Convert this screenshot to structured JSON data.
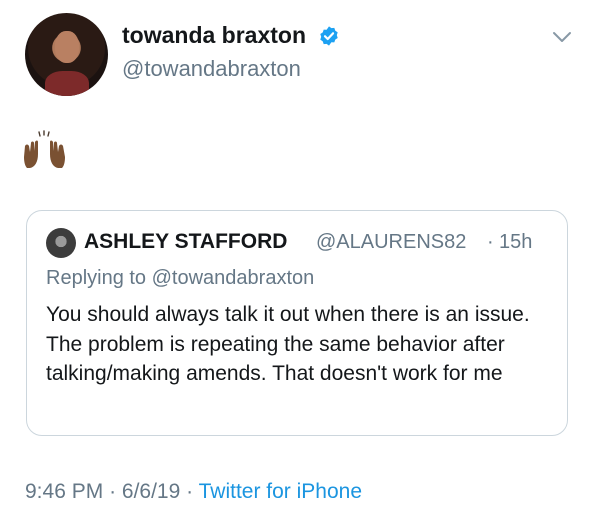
{
  "tweet": {
    "author_name": "towanda braxton",
    "author_handle": "@towandabraxton",
    "verified": true,
    "body_emoji": "🙌🏾",
    "time": "9:46 PM",
    "separator": "·",
    "date": "6/6/19",
    "source": "Twitter for iPhone"
  },
  "quoted_tweet": {
    "author_name": "ASHLEY STAFFORD",
    "author_handle": "@ALAURENS82",
    "separator": "·",
    "time_ago": "15h",
    "replying_label": "Replying to",
    "replying_to": "@towandabraxton",
    "text": "You should always talk it out when there is an issue. The problem is repeating the same behavior after talking/making amends. That doesn't work for me"
  },
  "colors": {
    "primary_text": "#14171a",
    "secondary_text": "#657786",
    "link": "#1b95e0",
    "verified_badge": "#1da1f2",
    "border": "#ccd6dd"
  },
  "icons": {
    "verified": "verified-badge-icon",
    "caret": "chevron-down-icon",
    "emoji": "raising-hands-emoji"
  }
}
